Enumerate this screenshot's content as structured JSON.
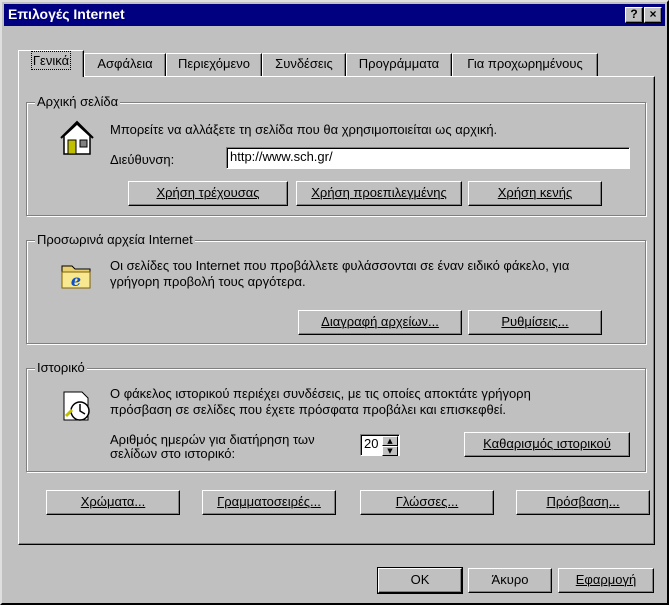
{
  "window": {
    "title": "Επιλογές Internet",
    "help_button": "?",
    "close_button": "×"
  },
  "tabs": [
    "Γενικά",
    "Ασφάλεια",
    "Περιεχόμενο",
    "Συνδέσεις",
    "Προγράμματα",
    "Για προχωρημένους"
  ],
  "active_tab": "Γενικά",
  "home_page": {
    "group_title": "Αρχική σελίδα",
    "description": "Μπορείτε να αλλάξετε τη σελίδα που θα χρησιμοποιείται ως αρχική.",
    "address_label": "Διεύθυνση:",
    "address_value": "http://www.sch.gr/",
    "use_current": "Χρήση τρέχουσας",
    "use_default": "Χρήση προεπιλεγμένης",
    "use_blank": "Χρήση κενής",
    "icon": "home-page-icon"
  },
  "temp_files": {
    "group_title": "Προσωρινά αρχεία Internet",
    "description_line1": "Οι σελίδες του Internet που προβάλλετε φυλάσσονται σε έναν ειδικό φάκελο, για",
    "description_line2": "γρήγορη προβολή τους αργότερα.",
    "delete_files": "Διαγραφή αρχείων...",
    "settings": "Ρυθμίσεις...",
    "icon": "ie-folder-icon"
  },
  "history": {
    "group_title": "Ιστορικό",
    "description_line1": "Ο φάκελος ιστορικού περιέχει συνδέσεις, με τις οποίες αποκτάτε γρήγορη",
    "description_line2": "πρόσβαση σε σελίδες που έχετε πρόσφατα προβάλει και επισκεφθεί.",
    "days_label_line1": "Αριθμός ημερών για διατήρηση των",
    "days_label_line2": "σελίδων στο ιστορικό:",
    "days_value": "20",
    "clear_history": "Καθαρισμός ιστορικού",
    "icon": "history-icon"
  },
  "bottom_buttons": {
    "colors": "Χρώματα...",
    "fonts": "Γραμματοσειρές...",
    "languages": "Γλώσσες...",
    "accessibility": "Πρόσβαση..."
  },
  "dialog_buttons": {
    "ok": "OK",
    "cancel": "Άκυρο",
    "apply": "Εφαρμογή"
  },
  "colors": {
    "titlebar": "#000080",
    "face": "#c0c0c0"
  }
}
